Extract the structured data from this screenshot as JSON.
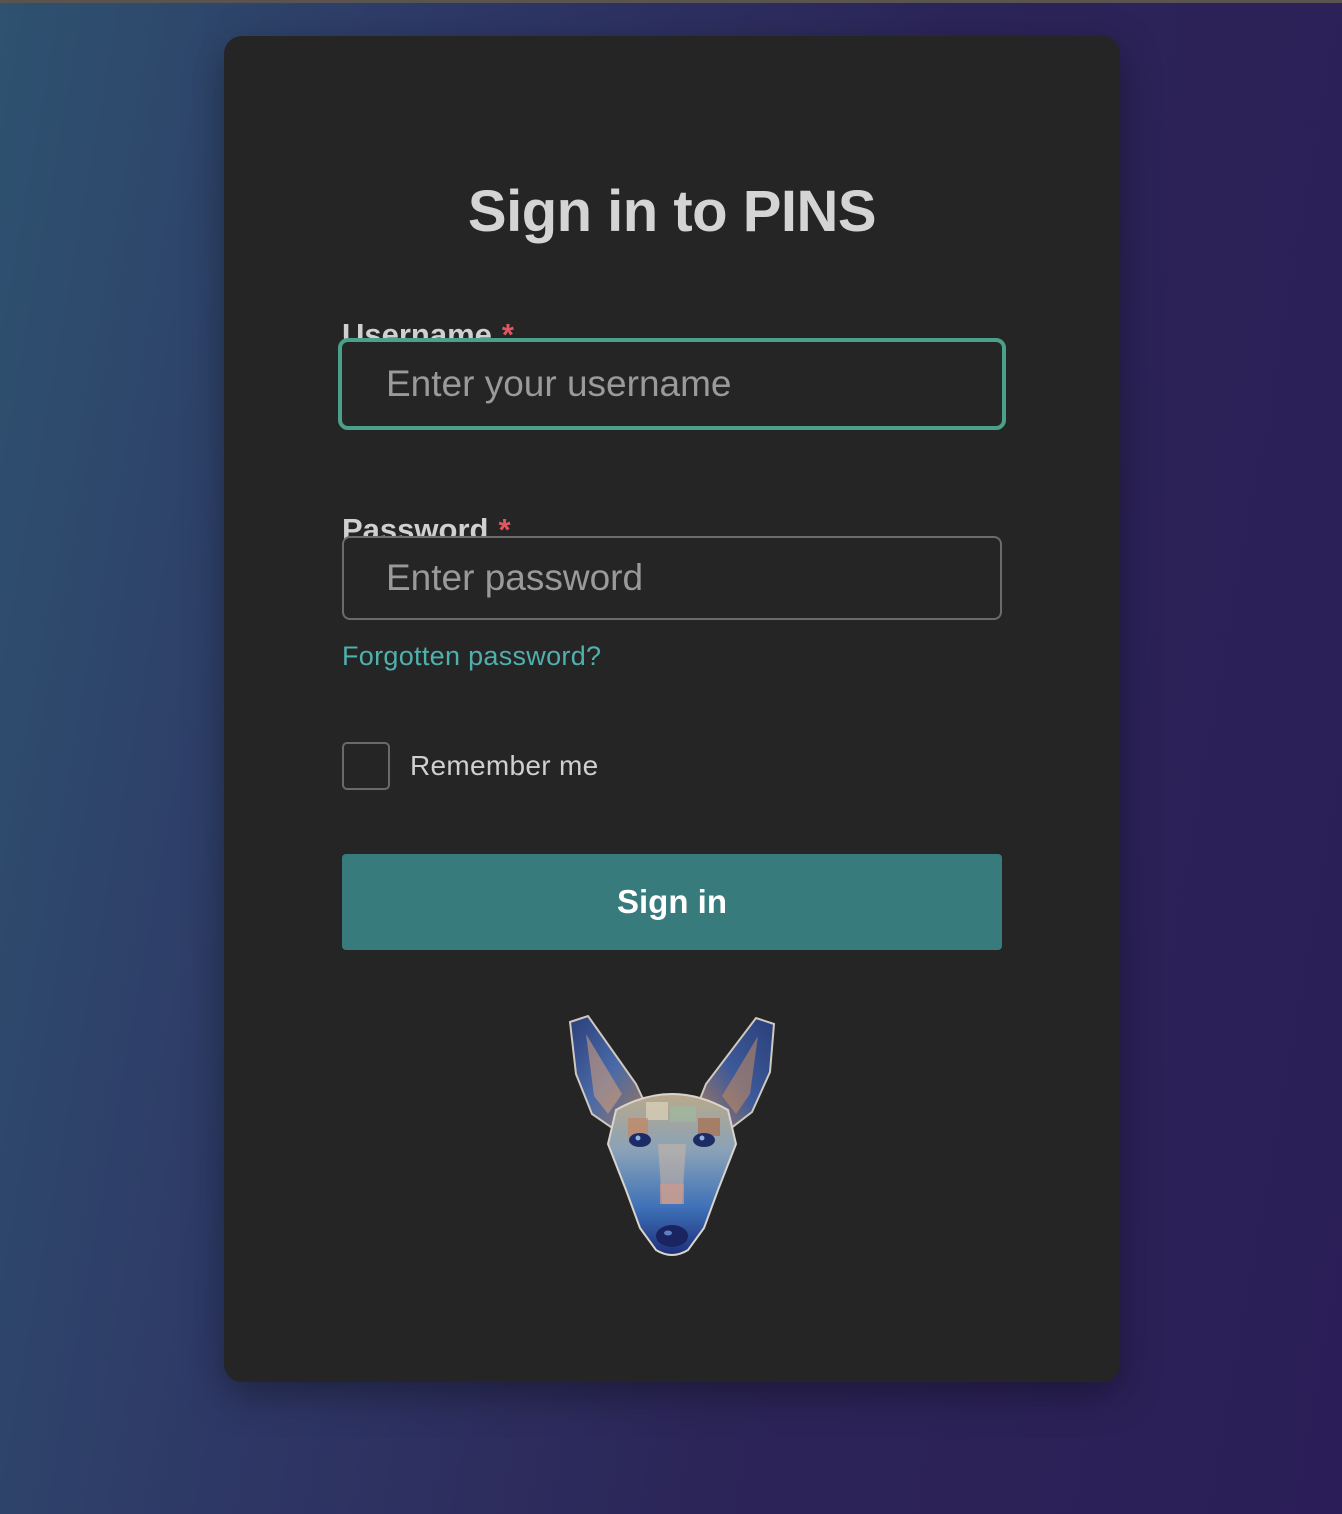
{
  "login": {
    "title": "Sign in to PINS",
    "username": {
      "label": "Username",
      "required_mark": "*",
      "placeholder": "Enter your username",
      "value": ""
    },
    "password": {
      "label": "Password",
      "required_mark": "*",
      "placeholder": "Enter password",
      "value": ""
    },
    "forgot_link": "Forgotten password?",
    "remember_me": {
      "label": "Remember me",
      "checked": false
    },
    "submit_label": "Sign in",
    "logo_icon": "dog-head-logo-icon"
  },
  "colors": {
    "accent": "#377b7d",
    "focus_border": "#4aa088",
    "link": "#4fb0ac",
    "required": "#e0575f",
    "card_background": "#252525"
  }
}
